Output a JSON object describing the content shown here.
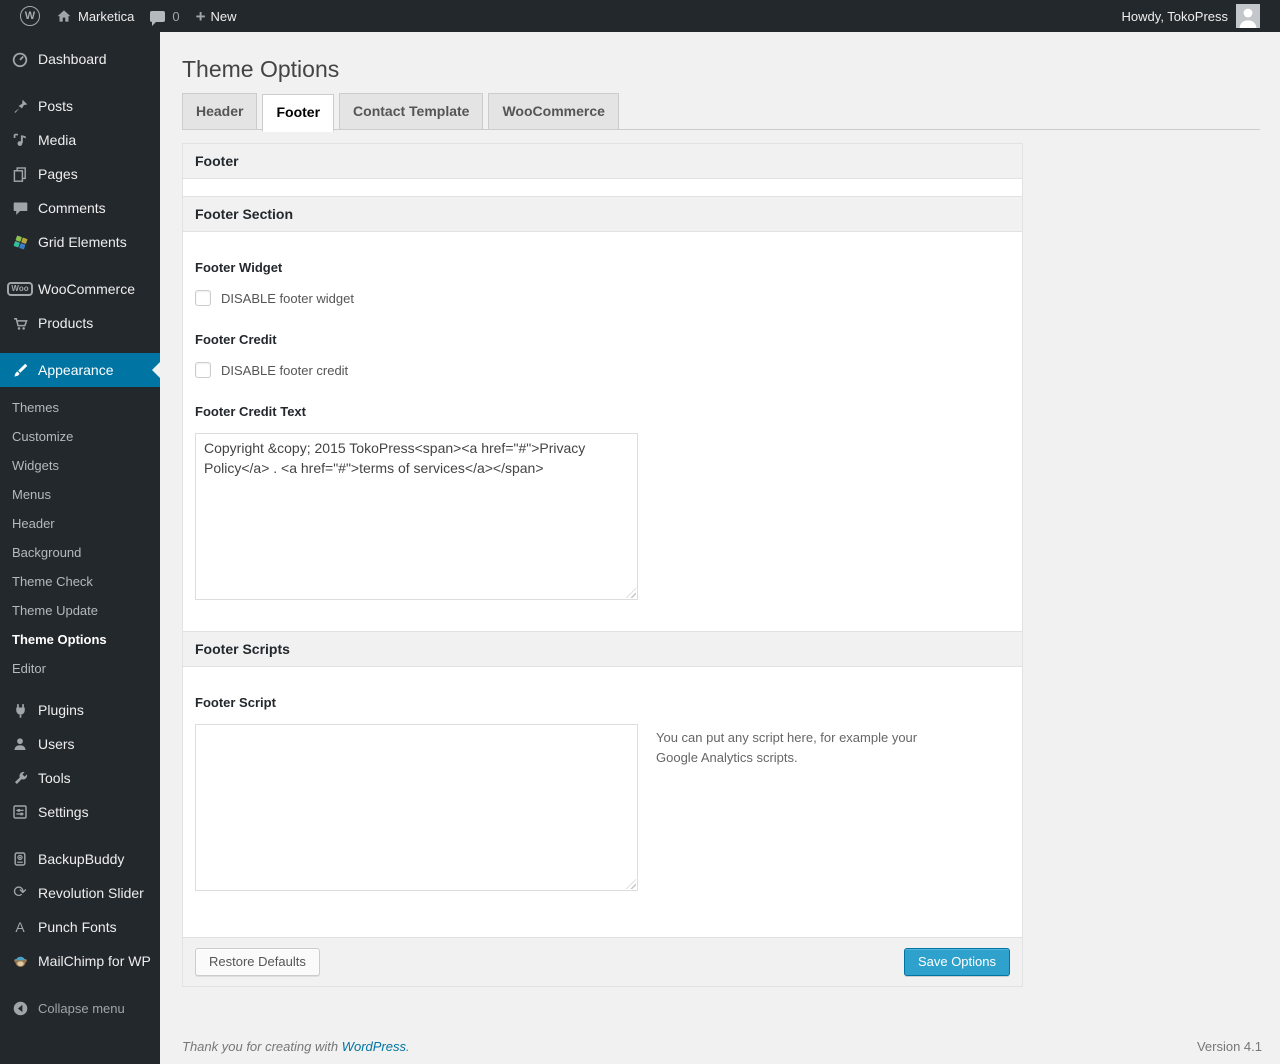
{
  "admin_bar": {
    "site_name": "Marketica",
    "comments_count": "0",
    "new_label": "New",
    "howdy": "Howdy, TokoPress"
  },
  "sidebar": {
    "items_top": [
      "Dashboard"
    ],
    "items_content": [
      "Posts",
      "Media",
      "Pages",
      "Comments",
      "Grid Elements"
    ],
    "items_shop": [
      "WooCommerce",
      "Products"
    ],
    "appearance": {
      "label": "Appearance",
      "submenu": [
        "Themes",
        "Customize",
        "Widgets",
        "Menus",
        "Header",
        "Background",
        "Theme Check",
        "Theme Update",
        "Theme Options",
        "Editor"
      ],
      "current_submenu": "Theme Options"
    },
    "items_admin": [
      "Plugins",
      "Users",
      "Tools",
      "Settings"
    ],
    "items_plugins": [
      "BackupBuddy",
      "Revolution Slider",
      "Punch Fonts",
      "MailChimp for WP"
    ],
    "collapse_label": "Collapse menu"
  },
  "page": {
    "title": "Theme Options",
    "tabs": [
      "Header",
      "Footer",
      "Contact Template",
      "WooCommerce"
    ],
    "active_tab": "Footer"
  },
  "panel": {
    "box_title": "Footer",
    "section_footer": {
      "title": "Footer Section",
      "footer_widget": {
        "label": "Footer Widget",
        "checkbox_label": "DISABLE footer widget",
        "checked": false
      },
      "footer_credit": {
        "label": "Footer Credit",
        "checkbox_label": "DISABLE footer credit",
        "checked": false
      },
      "footer_credit_text": {
        "label": "Footer Credit Text",
        "value": "Copyright &copy; 2015 TokoPress<span><a href=\"#\">Privacy Policy</a> . <a href=\"#\">terms of services</a></span>"
      }
    },
    "section_scripts": {
      "title": "Footer Scripts",
      "footer_script": {
        "label": "Footer Script",
        "value": "",
        "help": "You can put any script here, for example your Google Analytics scripts."
      }
    },
    "buttons": {
      "restore": "Restore Defaults",
      "save": "Save Options"
    }
  },
  "page_footer": {
    "thanks_prefix": "Thank you for creating with ",
    "thanks_link": "WordPress",
    "thanks_suffix": ".",
    "version": "Version 4.1"
  },
  "icons_text": {
    "wp_logo": "W",
    "plus": "+",
    "woo_badge": "Woo",
    "punch_fonts": "A",
    "rev_slider": "⟳"
  },
  "colors": {
    "admin_bar_bg": "#23282d",
    "menu_highlight": "#0074a2",
    "button_primary": "#2ea2cc",
    "link": "#0074a2",
    "page_bg": "#f1f1f1"
  }
}
